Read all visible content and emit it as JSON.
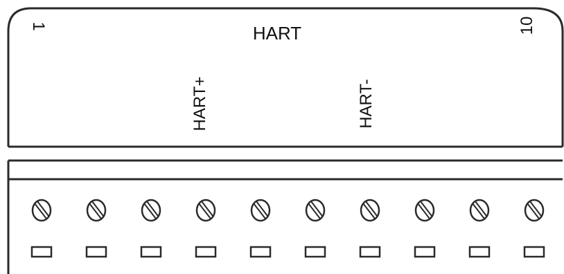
{
  "terminal_block": {
    "header_label": "HART",
    "first_number": "1",
    "last_number": "10",
    "signal_labels": [
      {
        "text": "HART+",
        "terminal": 4
      },
      {
        "text": "HART-",
        "terminal": 7
      }
    ],
    "terminal_count": 10,
    "line_color": "#2a2a2a",
    "background_color": "#ffffff"
  }
}
